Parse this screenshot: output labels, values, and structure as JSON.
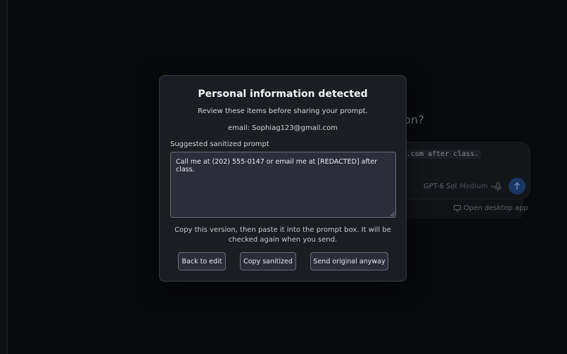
{
  "background": {
    "question_text": "on?",
    "composer_code": "l.com after class.",
    "model": "GPT-6 Sol",
    "model_effort": "Medium",
    "desktop_link": "Open desktop app"
  },
  "modal": {
    "title": "Personal information detected",
    "subtitle": "Review these items before sharing your prompt.",
    "detected_item": "email: Sophiag123@gmail.com",
    "suggested_label": "Suggested sanitized prompt",
    "sanitized_prompt": "Call me at (202) 555-0147 or email me at [REDACTED] after class.",
    "note": "Copy this version, then paste it into the prompt box. It will be checked again when you send.",
    "buttons": {
      "back": "Back to edit",
      "copy": "Copy sanitized",
      "send": "Send original anyway"
    }
  },
  "colors": {
    "modal_bg": "#1b1d23",
    "button_bg": "#2b2e39",
    "send_button_bg": "#1b3563"
  }
}
